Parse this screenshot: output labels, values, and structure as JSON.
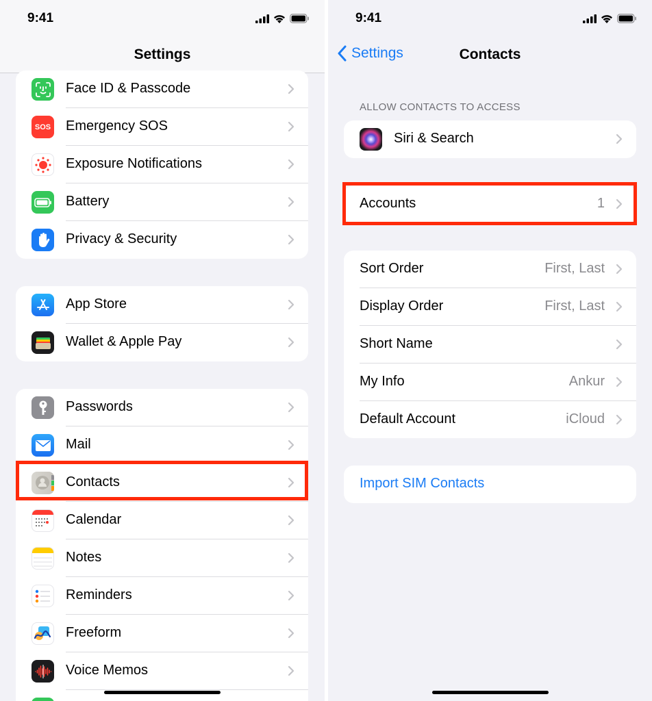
{
  "status": {
    "time": "9:41"
  },
  "left": {
    "title": "Settings",
    "groups": [
      {
        "items": [
          {
            "label": "Face ID & Passcode"
          },
          {
            "label": "Emergency SOS",
            "icon_text": "SOS"
          },
          {
            "label": "Exposure Notifications"
          },
          {
            "label": "Battery"
          },
          {
            "label": "Privacy & Security"
          }
        ]
      },
      {
        "items": [
          {
            "label": "App Store"
          },
          {
            "label": "Wallet & Apple Pay"
          }
        ]
      },
      {
        "items": [
          {
            "label": "Passwords"
          },
          {
            "label": "Mail"
          },
          {
            "label": "Contacts"
          },
          {
            "label": "Calendar"
          },
          {
            "label": "Notes"
          },
          {
            "label": "Reminders"
          },
          {
            "label": "Freeform"
          },
          {
            "label": "Voice Memos"
          }
        ]
      }
    ]
  },
  "right": {
    "back_label": "Settings",
    "title": "Contacts",
    "section_header": "ALLOW CONTACTS TO ACCESS",
    "siri": {
      "label": "Siri & Search"
    },
    "accounts": {
      "label": "Accounts",
      "value": "1"
    },
    "options": [
      {
        "label": "Sort Order",
        "value": "First, Last"
      },
      {
        "label": "Display Order",
        "value": "First, Last"
      },
      {
        "label": "Short Name",
        "value": ""
      },
      {
        "label": "My Info",
        "value": "Ankur"
      },
      {
        "label": "Default Account",
        "value": "iCloud"
      }
    ],
    "import": {
      "label": "Import SIM Contacts"
    }
  },
  "colors": {
    "accent": "#1a7cf5",
    "highlight": "#ff2a0a",
    "background": "#f2f2f7"
  }
}
